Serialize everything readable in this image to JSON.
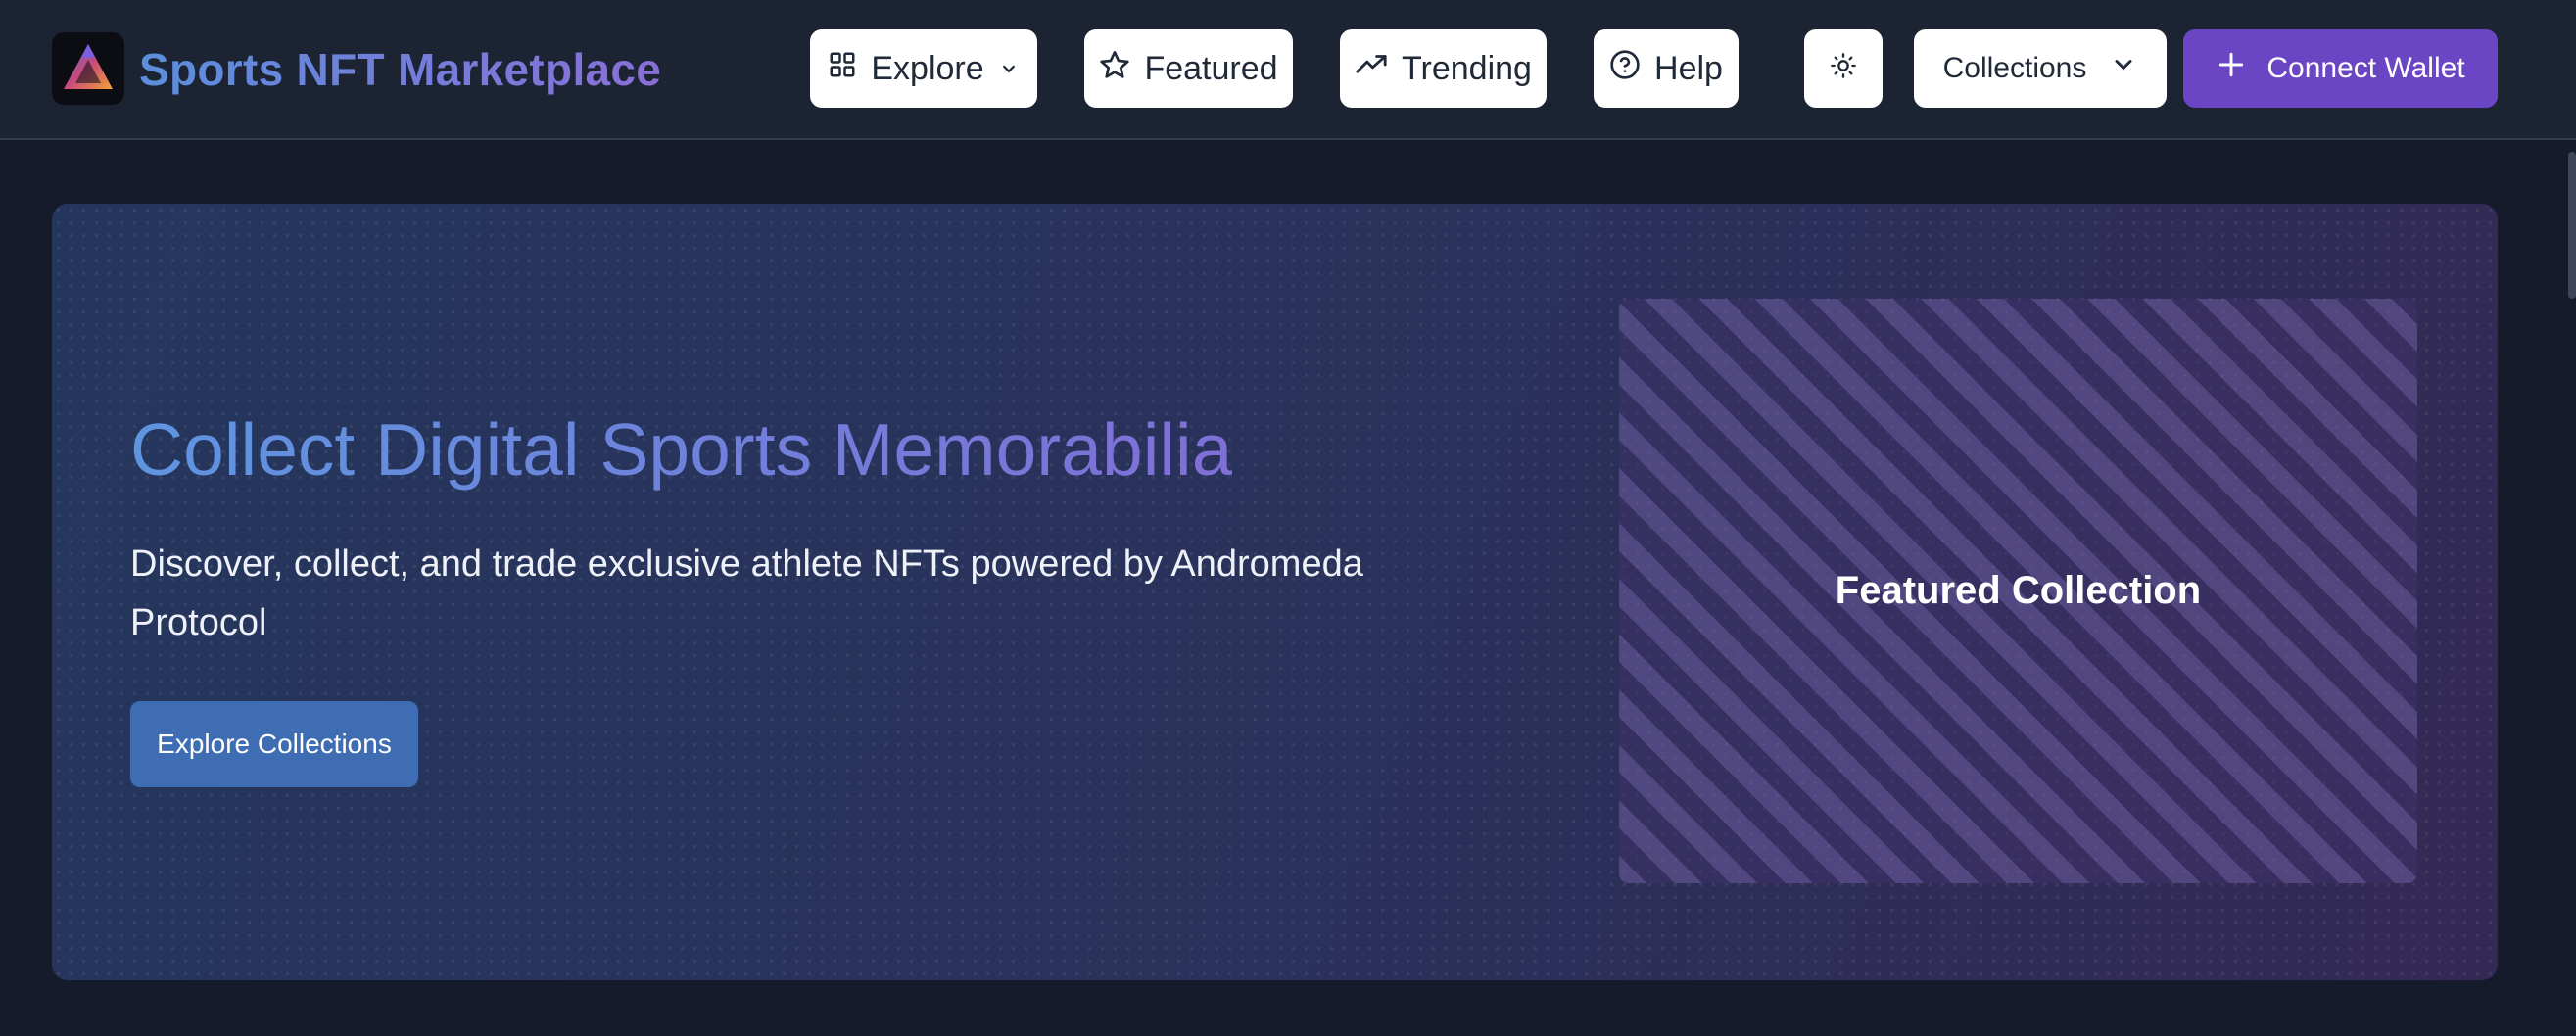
{
  "header": {
    "brand": "Sports NFT Marketplace",
    "nav": {
      "explore": "Explore",
      "featured": "Featured",
      "trending": "Trending",
      "help": "Help"
    },
    "collections": "Collections",
    "connect_wallet": "Connect Wallet"
  },
  "hero": {
    "title": "Collect Digital Sports Memorabilia",
    "subtitle": "Discover, collect, and trade exclusive athlete NFTs powered by Andromeda Protocol",
    "cta": "Explore Collections",
    "featured_label": "Featured Collection"
  },
  "icons": {
    "logo": "andromeda-logo-icon",
    "explore": "grid-icon",
    "featured": "star-icon",
    "trending": "trending-up-icon",
    "help": "help-circle-icon",
    "theme": "sun-icon",
    "collections": "chevron-down-icon",
    "wallet": "plus-icon"
  },
  "colors": {
    "header_bg": "#1c2434",
    "page_bg": "#151b2b",
    "accent": "#6a45c4",
    "cta_blue": "#3e6db3"
  }
}
